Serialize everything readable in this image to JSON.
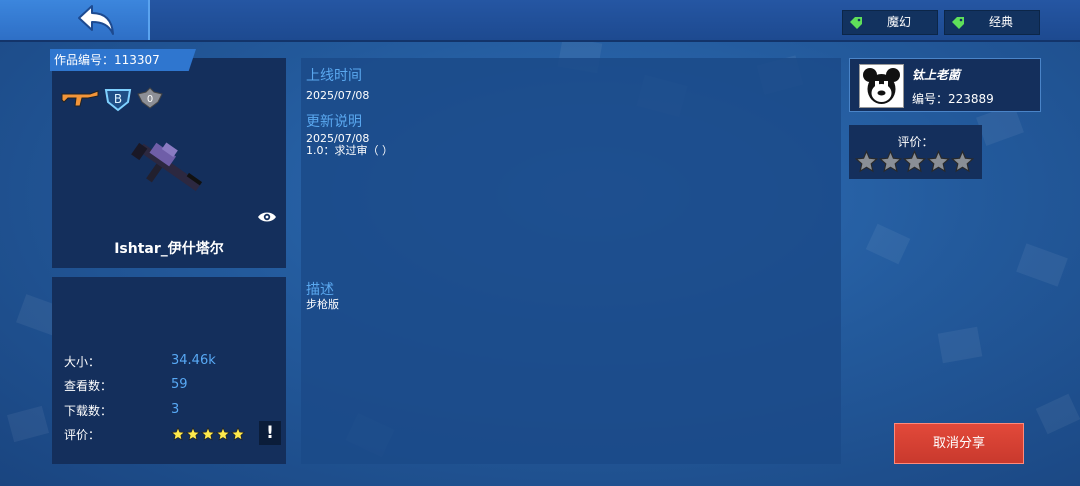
{
  "header": {
    "tags": [
      {
        "label": "魔幻",
        "icon": "tag-icon"
      },
      {
        "label": "经典",
        "icon": "tag-icon"
      }
    ]
  },
  "work": {
    "id_label": "作品编号：113307",
    "name": "Ishtar_伊什塔尔",
    "badges": [
      "rifle-icon",
      "b-grade-badge-icon",
      "zero-wing-badge-icon"
    ],
    "stats": [
      {
        "label": "大小：",
        "value": "34.46k"
      },
      {
        "label": "查看数：",
        "value": "59"
      },
      {
        "label": "下载数：",
        "value": "3"
      }
    ],
    "rating_label": "评价：",
    "rating_stars": 5,
    "report_label": "!"
  },
  "details": {
    "online_title": "上线时间",
    "online_date": "2025/07/08",
    "update_title": "更新说明",
    "update_date": "2025/07/08",
    "update_note": "1.0：求过审（ ）",
    "desc_title": "描述",
    "desc_text": "步枪版"
  },
  "author": {
    "name": "钛上老菌",
    "id_label": "编号：223889"
  },
  "user_rating": {
    "label": "评价：",
    "stars": 0
  },
  "actions": {
    "cancel_share": "取消分享"
  },
  "colors": {
    "accent": "#2f76cf",
    "panel": "#142f5c",
    "danger": "#d9412f",
    "star_filled": "#ffe94d",
    "star_empty": "#8a8f96"
  }
}
